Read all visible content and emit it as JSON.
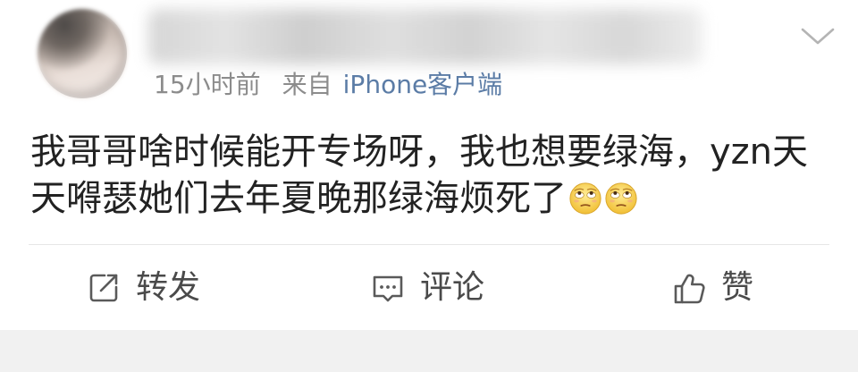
{
  "post": {
    "menu_icon": "chevron-down-icon",
    "meta": {
      "time": "15小时前",
      "source_prefix": "来自",
      "source": "iPhone客户端"
    },
    "text_lines": [
      "我哥哥啥时候能开专场呀，我也想要绿海，yzn天",
      "天嘚瑟她们去年夏晚那绿海烦死了"
    ],
    "emojis": [
      "eye-roll-emoji",
      "eye-roll-emoji"
    ]
  },
  "actions": [
    {
      "label": "转发",
      "icon": "share-icon"
    },
    {
      "label": "评论",
      "icon": "comment-icon"
    },
    {
      "label": "赞",
      "icon": "thumbs-up-icon"
    }
  ],
  "colors": {
    "text": "#222222",
    "meta": "#8c8c8c",
    "source": "#5b7ca6",
    "action": "#4a4a4a",
    "divider": "#e6e6e6",
    "footer": "#f1f1f1"
  }
}
